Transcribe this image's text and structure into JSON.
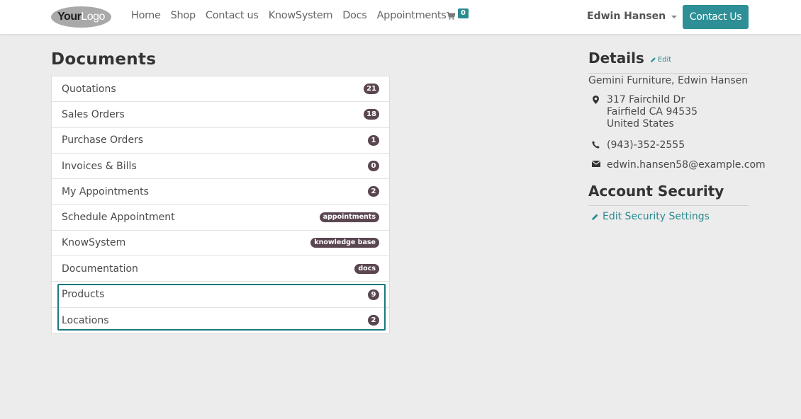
{
  "navbar": {
    "logo_your": "Your",
    "logo_word": "Logo",
    "links": [
      "Home",
      "Shop",
      "Contact us",
      "KnowSystem",
      "Docs",
      "Appointments"
    ],
    "cart_count": "0",
    "user_name": "Edwin Hansen",
    "contact_button": "Contact Us",
    "accent_color": "#2e8f96"
  },
  "documents": {
    "title": "Documents",
    "items": [
      {
        "label": "Quotations",
        "badge": "21",
        "badge_kind": "count"
      },
      {
        "label": "Sales Orders",
        "badge": "18",
        "badge_kind": "count"
      },
      {
        "label": "Purchase Orders",
        "badge": "1",
        "badge_kind": "count"
      },
      {
        "label": "Invoices & Bills",
        "badge": "0",
        "badge_kind": "count"
      },
      {
        "label": "My Appointments",
        "badge": "2",
        "badge_kind": "count"
      },
      {
        "label": "Schedule Appointment",
        "badge": "appointments",
        "badge_kind": "text"
      },
      {
        "label": "KnowSystem",
        "badge": "knowledge base",
        "badge_kind": "text"
      },
      {
        "label": "Documentation",
        "badge": "docs",
        "badge_kind": "text"
      },
      {
        "label": "Products",
        "badge": "9",
        "badge_kind": "count"
      },
      {
        "label": "Locations",
        "badge": "2",
        "badge_kind": "count"
      }
    ],
    "badge_color": "#5a4651",
    "highlight_color": "#1b7a80"
  },
  "details": {
    "title": "Details",
    "edit_label": "Edit",
    "company": "Gemini Furniture, Edwin Hansen",
    "address_line1": "317 Fairchild Dr",
    "address_line2": "Fairfield CA 94535",
    "address_line3": "United States",
    "phone": "(943)-352-2555",
    "email": "edwin.hansen58@example.com"
  },
  "security": {
    "title": "Account Security",
    "edit_link": "Edit Security Settings"
  }
}
